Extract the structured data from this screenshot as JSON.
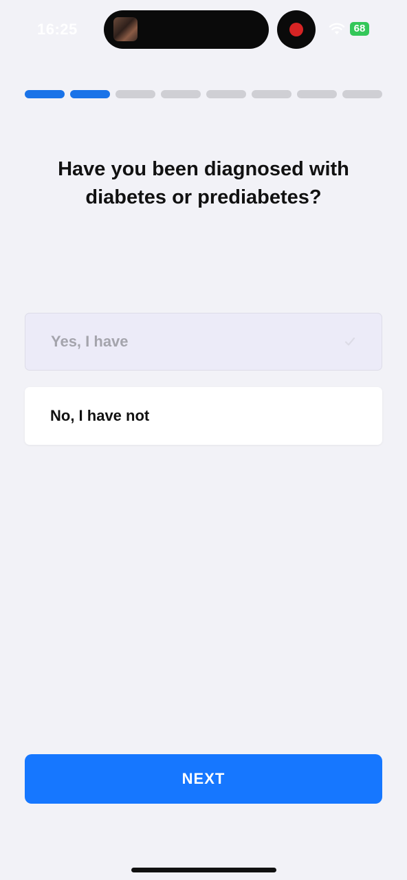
{
  "status_bar": {
    "time": "16:25",
    "battery": "68"
  },
  "progress": {
    "total_steps": 8,
    "completed_steps": 2
  },
  "question": {
    "text": "Have you been diagnosed with diabetes or prediabetes?"
  },
  "options": [
    {
      "label": "Yes, I have"
    },
    {
      "label": "No, I have not"
    }
  ],
  "next_button": {
    "label": "NEXT"
  },
  "colors": {
    "accent": "#1677ff",
    "progress_active": "#1a73e8",
    "progress_inactive": "#cfcfd4",
    "background": "#f2f2f7",
    "battery": "#34c759",
    "record": "#d62424"
  }
}
